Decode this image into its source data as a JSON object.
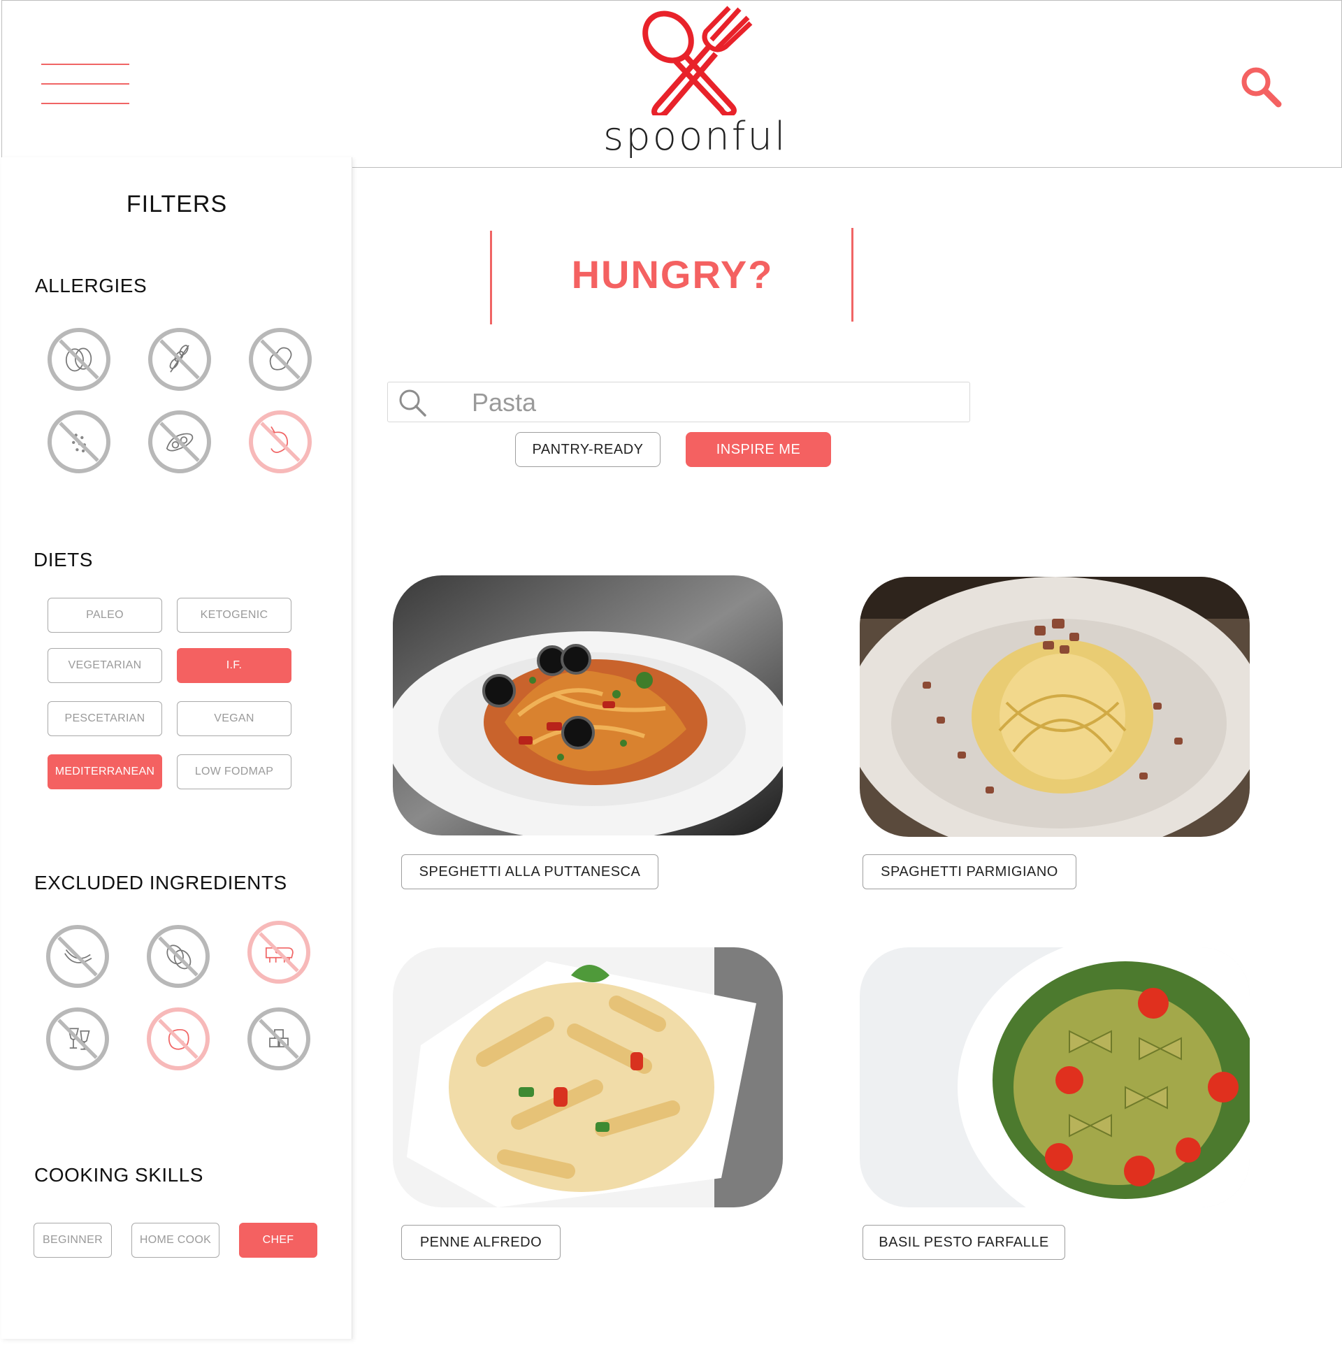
{
  "header": {
    "brand": "spoonful",
    "menu_icon": "hamburger-menu-icon",
    "logo_icon": "spoon-fork-cross-icon",
    "search_icon": "search-icon"
  },
  "colors": {
    "accent": "#f46161",
    "accent_light": "#f7b9b9",
    "neutral_border": "#b8b8b8"
  },
  "sidebar": {
    "title": "FILTERS",
    "allergies": {
      "title": "ALLERGIES",
      "items": [
        {
          "icon": "no-egg-icon",
          "active": false
        },
        {
          "icon": "no-wheat-icon",
          "active": false
        },
        {
          "icon": "no-peanut-icon",
          "active": false
        },
        {
          "icon": "no-sesame-icon",
          "active": false
        },
        {
          "icon": "no-soy-icon",
          "active": false
        },
        {
          "icon": "no-shellfish-icon",
          "active": true
        }
      ]
    },
    "diets": {
      "title": "DIETS",
      "items": [
        {
          "label": "PALEO",
          "active": false
        },
        {
          "label": "KETOGENIC",
          "active": false
        },
        {
          "label": "VEGETARIAN",
          "active": false
        },
        {
          "label": "I.F.",
          "active": true
        },
        {
          "label": "PESCETARIAN",
          "active": false
        },
        {
          "label": "VEGAN",
          "active": false
        },
        {
          "label": "MEDITERRANEAN",
          "active": true
        },
        {
          "label": "LOW FODMAP",
          "active": false
        }
      ]
    },
    "excluded": {
      "title": "EXCLUDED INGREDIENTS",
      "items": [
        {
          "icon": "no-banana-icon",
          "active": false
        },
        {
          "icon": "no-nuts-icon",
          "active": false
        },
        {
          "icon": "no-beef-icon",
          "active": true
        },
        {
          "icon": "no-alcohol-icon",
          "active": false
        },
        {
          "icon": "no-potato-icon",
          "active": true
        },
        {
          "icon": "no-sugar-icon",
          "active": false
        }
      ]
    },
    "skills": {
      "title": "COOKING SKILLS",
      "items": [
        {
          "label": "BEGINNER",
          "active": false
        },
        {
          "label": "HOME COOK",
          "active": false
        },
        {
          "label": "CHEF",
          "active": true
        }
      ]
    }
  },
  "main": {
    "headline": "HUNGRY?",
    "search": {
      "value": "Pasta",
      "icon": "search-icon"
    },
    "buttons": {
      "pantry": "PANTRY-READY",
      "inspire": "INSPIRE ME"
    },
    "recipes": [
      {
        "title": "SPEGHETTI ALLA PUTTANESCA"
      },
      {
        "title": "SPAGHETTI PARMIGIANO"
      },
      {
        "title": "PENNE ALFREDO"
      },
      {
        "title": "BASIL PESTO FARFALLE"
      }
    ]
  }
}
